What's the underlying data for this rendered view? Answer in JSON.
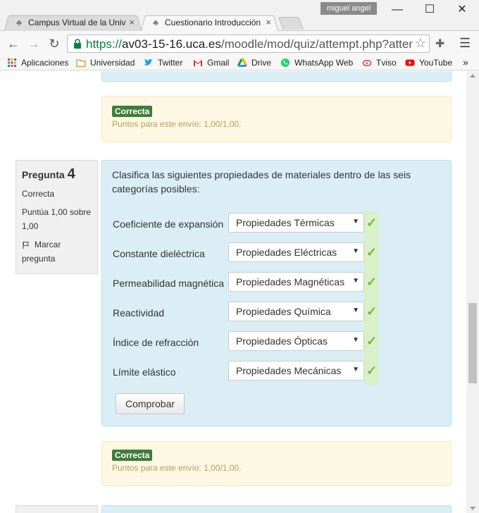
{
  "browser": {
    "tabs": [
      {
        "label": "Campus Virtual de la Univ",
        "close": "×"
      },
      {
        "label": "Cuestionario Introducción",
        "close": "×"
      }
    ],
    "user": "miguel angel",
    "window_controls": {
      "minimize": "—",
      "maximize": "☐",
      "close": "✕"
    },
    "url_scheme": "https://",
    "url_host": "av03-15-16.uca.es",
    "url_path": "/moodle/mod/quiz/attempt.php?attemp",
    "bookmarks": [
      {
        "label": "Aplicaciones",
        "icon": "apps-grid-icon"
      },
      {
        "label": "Universidad",
        "icon": "folder-icon"
      },
      {
        "label": "Twitter",
        "icon": "twitter-icon"
      },
      {
        "label": "Gmail",
        "icon": "gmail-icon"
      },
      {
        "label": "Drive",
        "icon": "drive-icon"
      },
      {
        "label": "WhatsApp Web",
        "icon": "whatsapp-icon"
      },
      {
        "label": "Tviso",
        "icon": "tviso-icon"
      },
      {
        "label": "YouTube",
        "icon": "youtube-icon"
      }
    ],
    "bookmarks_overflow": "»"
  },
  "prev_feedback": {
    "badge": "Correcta",
    "text": "Puntos para este envío: 1,00/1,00."
  },
  "question": {
    "title": "Pregunta",
    "number": "4",
    "state": "Correcta",
    "grade": "Puntúa 1,00 sobre 1,00",
    "flag": "Marcar pregunta",
    "text": "Clasifica las siguientes propiedades de materiales dentro de las seis categorías posibles:",
    "rows": [
      {
        "label": "Coeficiente de expansión",
        "value": "Propiedades Térmicas"
      },
      {
        "label": "Constante dieléctrica",
        "value": "Propiedades Eléctricas"
      },
      {
        "label": "Permeabilidad magnética",
        "value": "Propiedades Magnéticas"
      },
      {
        "label": "Reactividad",
        "value": "Propiedades Química"
      },
      {
        "label": "Índice de refracción",
        "value": "Propiedades Ópticas"
      },
      {
        "label": "Límite elástico",
        "value": "Propiedades Mecánicas"
      }
    ],
    "check_button": "Comprobar",
    "feedback_badge": "Correcta",
    "feedback_text": "Puntos para este envío: 1,00/1,00."
  },
  "colors": {
    "correct_badge": "#3e7d3a",
    "question_bg": "#dbeef6",
    "feedback_bg": "#fcf8e3",
    "checkmark": "#6fb83c"
  }
}
